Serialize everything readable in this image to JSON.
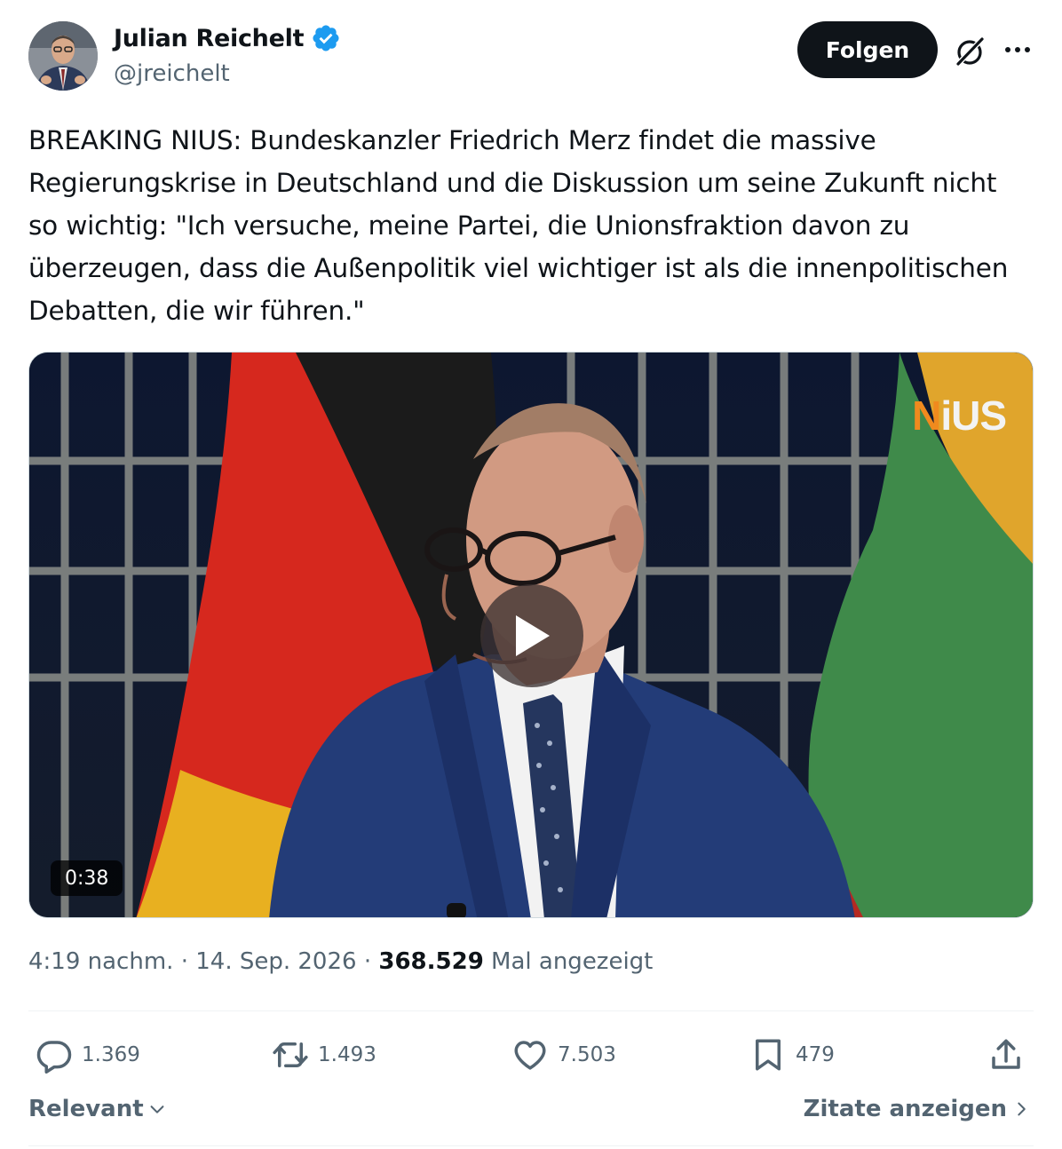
{
  "author": {
    "name": "Julian Reichelt",
    "handle": "@jreichelt",
    "verified": true
  },
  "header": {
    "follow_label": "Folgen"
  },
  "tweet": {
    "text": "BREAKING NIUS: Bundeskanzler Friedrich Merz findet die massive Regierungskrise in Deutschland und die Diskussion um seine Zukunft nicht so wichtig: \"Ich versuche, meine Partei, die Unionsfraktion davon zu überzeugen, dass die Außenpolitik viel wichtiger ist als die innenpolitischen Debatten, die wir führen.\""
  },
  "media": {
    "logo": {
      "first": "N",
      "rest": "iUS"
    },
    "duration": "0:38"
  },
  "meta": {
    "time": "4:19 nachm.",
    "separator": "·",
    "date": "14. Sep. 2026",
    "views": "368.529",
    "views_label": "Mal angezeigt"
  },
  "actions": {
    "replies": "1.369",
    "reposts": "1.493",
    "likes": "7.503",
    "bookmarks": "479"
  },
  "footer": {
    "sort_label": "Relevant",
    "quotes_label": "Zitate anzeigen"
  },
  "colors": {
    "accent_blue": "#1d9bf0",
    "text_primary": "#0f1419",
    "text_secondary": "#536471",
    "nius_orange": "#f08a1e"
  },
  "icons": [
    "verified-badge-icon",
    "grok-icon",
    "more-icon",
    "play-icon",
    "reply-icon",
    "repost-icon",
    "like-icon",
    "bookmark-icon",
    "share-icon",
    "chevron-down-icon",
    "chevron-right-icon"
  ]
}
